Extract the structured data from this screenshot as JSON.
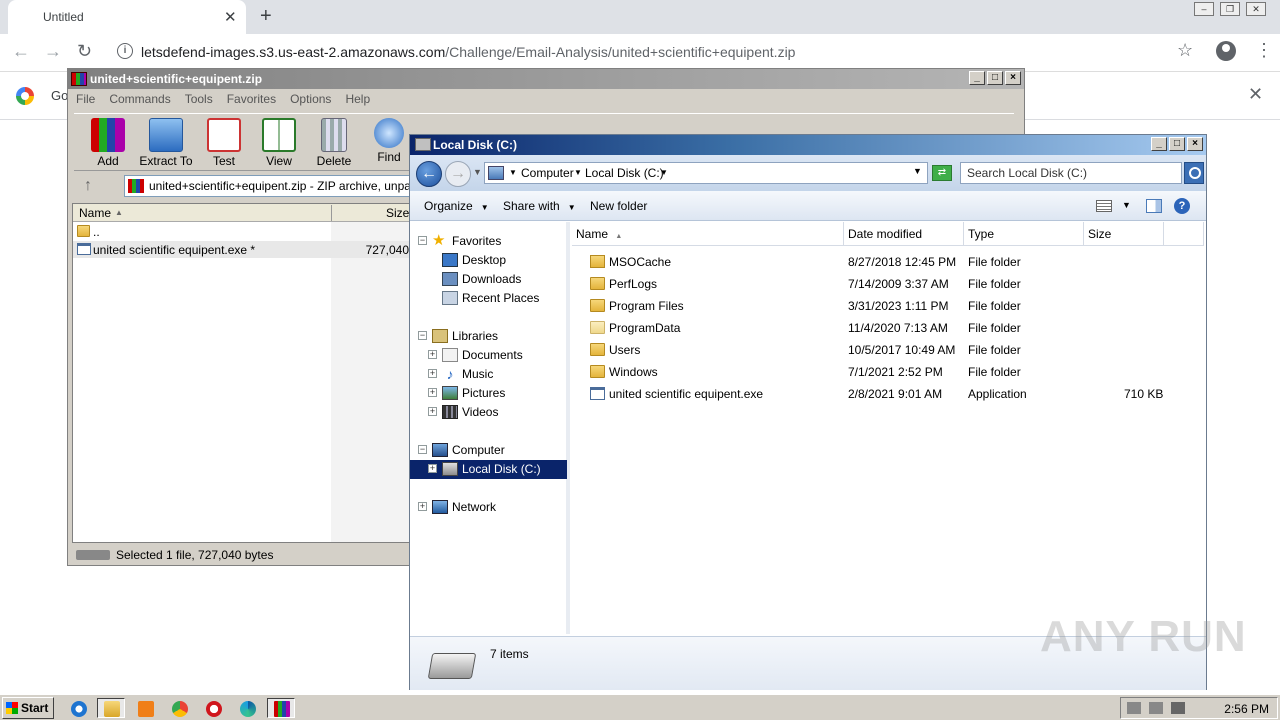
{
  "browser": {
    "tab_title": "Untitled",
    "url_host": "letsdefend-images.s3.us-east-2.amazonaws.com",
    "url_path": "/Challenge/Email-Analysis/united+scientific+equipent.zip",
    "infobar_text": "Go"
  },
  "winrar": {
    "title": "united+scientific+equipent.zip",
    "menu": [
      "File",
      "Commands",
      "Tools",
      "Favorites",
      "Options",
      "Help"
    ],
    "toolbar": [
      "Add",
      "Extract To",
      "Test",
      "View",
      "Delete",
      "Find"
    ],
    "address": "united+scientific+equipent.zip - ZIP archive, unpacked",
    "columns": {
      "name": "Name",
      "size": "Size"
    },
    "rows": [
      {
        "name": "..",
        "size": ""
      },
      {
        "name": "united scientific equipent.exe *",
        "size": "727,040"
      }
    ],
    "status": "Selected 1 file, 727,040 bytes"
  },
  "explorer": {
    "title": "Local Disk (C:)",
    "breadcrumb": [
      "Computer",
      "Local Disk (C:)"
    ],
    "search_placeholder": "Search Local Disk (C:)",
    "commands": [
      "Organize",
      "Share with",
      "New folder"
    ],
    "tree": {
      "favorites": "Favorites",
      "desktop": "Desktop",
      "downloads": "Downloads",
      "recent": "Recent Places",
      "libraries": "Libraries",
      "documents": "Documents",
      "music": "Music",
      "pictures": "Pictures",
      "videos": "Videos",
      "computer": "Computer",
      "local_disk": "Local Disk (C:)",
      "network": "Network"
    },
    "columns": {
      "name": "Name",
      "date": "Date modified",
      "type": "Type",
      "size": "Size"
    },
    "files": [
      {
        "name": "MSOCache",
        "date": "8/27/2018 12:45 PM",
        "type": "File folder",
        "size": "",
        "icon": "locked-folder-icon"
      },
      {
        "name": "PerfLogs",
        "date": "7/14/2009 3:37 AM",
        "type": "File folder",
        "size": "",
        "icon": "folder-icon"
      },
      {
        "name": "Program Files",
        "date": "3/31/2023 1:11 PM",
        "type": "File folder",
        "size": "",
        "icon": "folder-icon"
      },
      {
        "name": "ProgramData",
        "date": "11/4/2020 7:13 AM",
        "type": "File folder",
        "size": "",
        "icon": "hidden-folder-icon"
      },
      {
        "name": "Users",
        "date": "10/5/2017 10:49 AM",
        "type": "File folder",
        "size": "",
        "icon": "folder-icon"
      },
      {
        "name": "Windows",
        "date": "7/1/2021 2:52 PM",
        "type": "File folder",
        "size": "",
        "icon": "folder-icon"
      },
      {
        "name": "united scientific equipent.exe",
        "date": "2/8/2021 9:01 AM",
        "type": "Application",
        "size": "710 KB",
        "icon": "application-icon"
      }
    ],
    "item_count": "7 items"
  },
  "taskbar": {
    "start": "Start",
    "clock": "2:56 PM"
  },
  "watermark": "ANY RUN"
}
